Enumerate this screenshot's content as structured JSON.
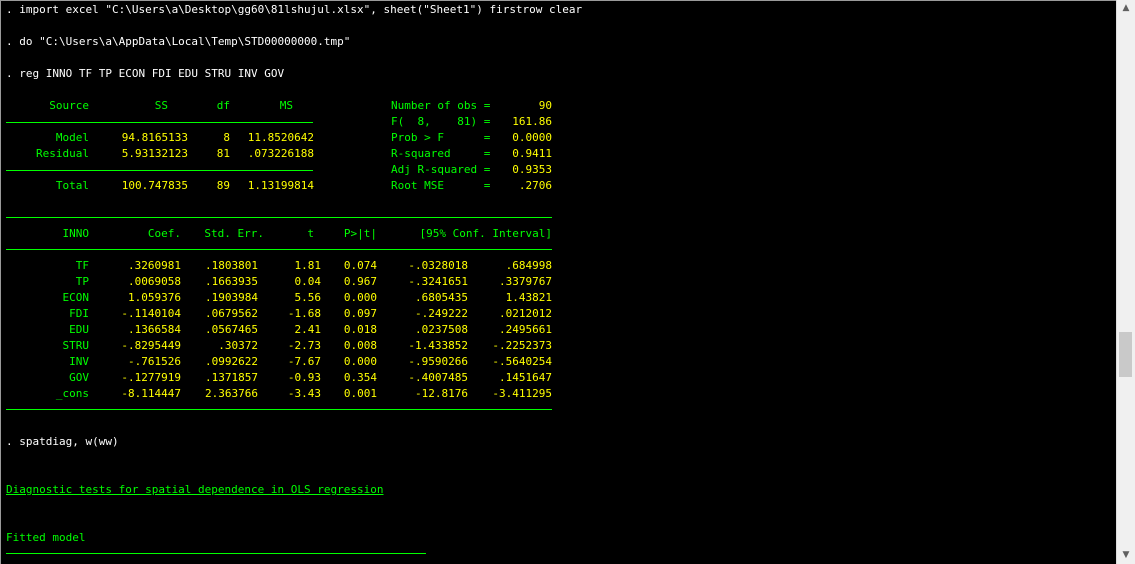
{
  "commands": {
    "import": ". import excel \"C:\\Users\\a\\Desktop\\gg60\\81lshujul.xlsx\", sheet(\"Sheet1\") firstrow clear",
    "do": ". do \"C:\\Users\\a\\AppData\\Local\\Temp\\STD00000000.tmp\"",
    "reg": ". reg INNO TF TP ECON FDI EDU STRU INV GOV",
    "spatdiag": ". spatdiag, w(ww)"
  },
  "anova": {
    "header": {
      "source": "Source",
      "ss": "SS",
      "df": "df",
      "ms": "MS"
    },
    "rows": [
      {
        "source": "Model",
        "ss": "94.8165133",
        "df": "8",
        "ms": "11.8520642"
      },
      {
        "source": "Residual",
        "ss": "5.93132123",
        "df": "81",
        "ms": ".073226188"
      }
    ],
    "total": {
      "source": "Total",
      "ss": "100.747835",
      "df": "89",
      "ms": "1.13199814"
    }
  },
  "stats": [
    {
      "label": "Number of obs =",
      "value": "90"
    },
    {
      "label": "F(  8,    81) =",
      "value": "161.86"
    },
    {
      "label": "Prob > F      =",
      "value": "0.0000"
    },
    {
      "label": "R-squared     =",
      "value": "0.9411"
    },
    {
      "label": "Adj R-squared =",
      "value": "0.9353"
    },
    {
      "label": "Root MSE      =",
      "value": ".2706"
    }
  ],
  "coef_table": {
    "header": {
      "var": "INNO",
      "coef": "Coef.",
      "se": "Std. Err.",
      "t": "t",
      "p": "P>|t|",
      "ci": "[95% Conf. Interval]"
    },
    "rows": [
      {
        "var": "TF",
        "coef": ".3260981",
        "se": ".1803801",
        "t": "1.81",
        "p": "0.074",
        "lo": "-.0328018",
        "hi": ".684998"
      },
      {
        "var": "TP",
        "coef": ".0069058",
        "se": ".1663935",
        "t": "0.04",
        "p": "0.967",
        "lo": "-.3241651",
        "hi": ".3379767"
      },
      {
        "var": "ECON",
        "coef": "1.059376",
        "se": ".1903984",
        "t": "5.56",
        "p": "0.000",
        "lo": ".6805435",
        "hi": "1.43821"
      },
      {
        "var": "FDI",
        "coef": "-.1140104",
        "se": ".0679562",
        "t": "-1.68",
        "p": "0.097",
        "lo": "-.249222",
        "hi": ".0212012"
      },
      {
        "var": "EDU",
        "coef": ".1366584",
        "se": ".0567465",
        "t": "2.41",
        "p": "0.018",
        "lo": ".0237508",
        "hi": ".2495661"
      },
      {
        "var": "STRU",
        "coef": "-.8295449",
        "se": ".30372",
        "t": "-2.73",
        "p": "0.008",
        "lo": "-1.433852",
        "hi": "-.2252373"
      },
      {
        "var": "INV",
        "coef": "-.761526",
        "se": ".0992622",
        "t": "-7.67",
        "p": "0.000",
        "lo": "-.9590266",
        "hi": "-.5640254"
      },
      {
        "var": "GOV",
        "coef": "-.1277919",
        "se": ".1371857",
        "t": "-0.93",
        "p": "0.354",
        "lo": "-.4007485",
        "hi": ".1451647"
      },
      {
        "var": "_cons",
        "coef": "-8.114447",
        "se": "2.363766",
        "t": "-3.43",
        "p": "0.001",
        "lo": "-12.8176",
        "hi": "-3.411295"
      }
    ]
  },
  "diagnostic": {
    "title": "Diagnostic tests for spatial dependence in OLS regression",
    "fitted": "Fitted model"
  },
  "colors": {
    "background": "#000000",
    "command": "#ffffff",
    "label": "#00ff00",
    "value": "#ffff00"
  },
  "scrollbar": {
    "up_icon": "arrow-up-icon",
    "down_icon": "arrow-down-icon"
  }
}
